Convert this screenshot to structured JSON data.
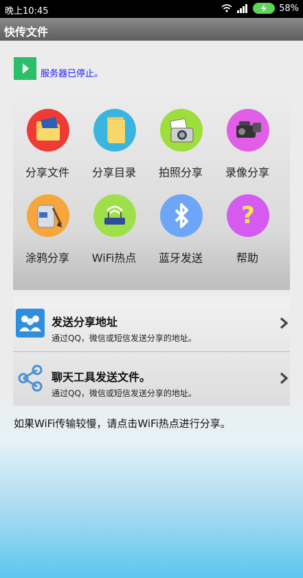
{
  "status_bar": {
    "time": "晚上10:45",
    "battery": "58%"
  },
  "app": {
    "title": "快传文件"
  },
  "server": {
    "status": "服务器已停止。"
  },
  "grid": {
    "items": [
      {
        "label": "分享文件",
        "icon": "folder-share-icon",
        "color": "#ee3b36"
      },
      {
        "label": "分享目录",
        "icon": "folder-icon",
        "color": "#3ab5e0"
      },
      {
        "label": "拍照分享",
        "icon": "camera-icon",
        "color": "#9dde3a"
      },
      {
        "label": "录像分享",
        "icon": "video-camera-icon",
        "color": "#e15ee6"
      },
      {
        "label": "涂鸦分享",
        "icon": "paint-bucket-icon",
        "color": "#f7a63b"
      },
      {
        "label": "WiFi热点",
        "icon": "wifi-router-icon",
        "color": "#9fe04a"
      },
      {
        "label": "蓝牙发送",
        "icon": "bluetooth-icon",
        "color": "#6ea6f7"
      },
      {
        "label": "帮助",
        "icon": "help-icon",
        "color": "#d55bf0"
      }
    ]
  },
  "list": {
    "items": [
      {
        "title": "发送分享地址",
        "subtitle": "通过QQ，微信或短信发送分享的地址。",
        "icon": "contacts-icon"
      },
      {
        "title": "聊天工具发送文件。",
        "subtitle": "通过QQ，微信或短信发送分享的地址。",
        "icon": "share-icon"
      }
    ]
  },
  "hint": "如果WiFi传输较慢，请点击WiFi热点进行分享。"
}
